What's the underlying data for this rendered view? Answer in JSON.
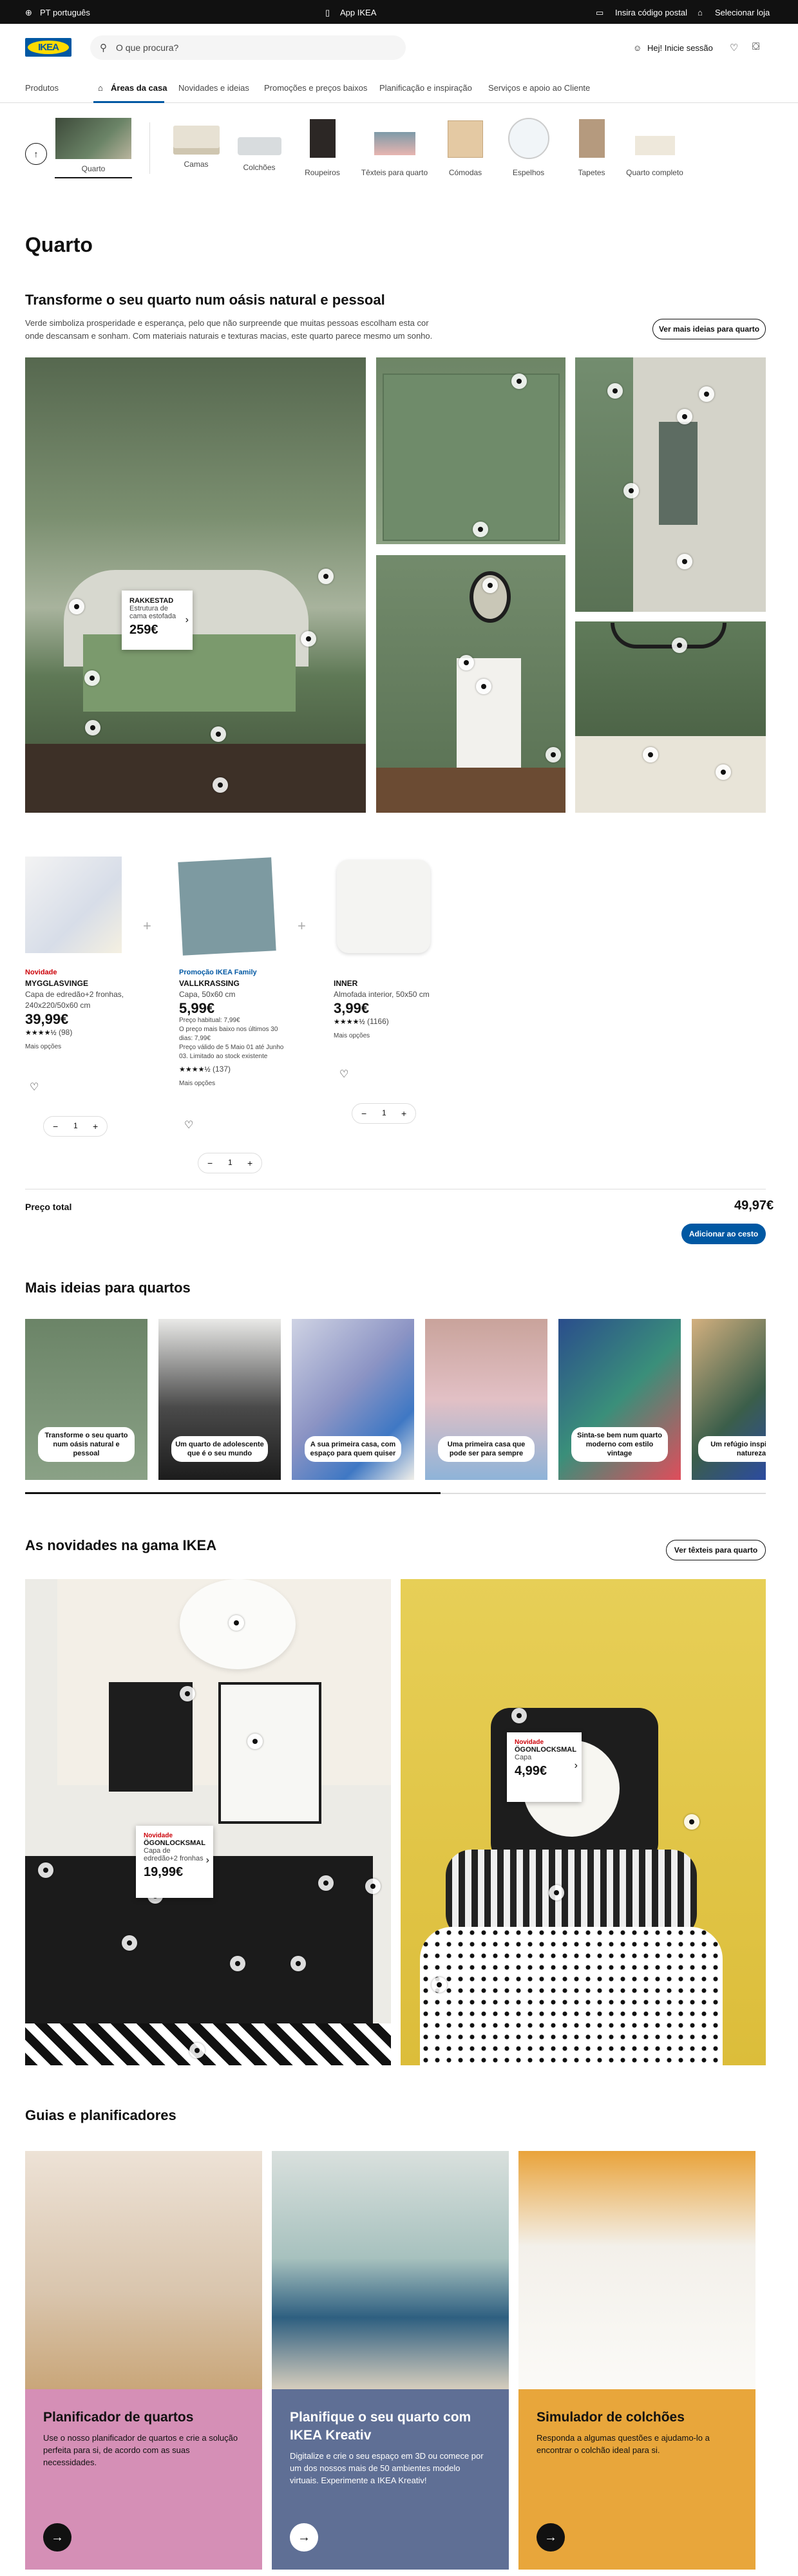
{
  "topbar": {
    "country": "PT",
    "language": "português",
    "app": "App IKEA",
    "postal": "Insira código postal",
    "store": "Selecionar loja"
  },
  "header": {
    "logo": "IKEA",
    "search_placeholder": "O que procura?",
    "login": "Hej! Inicie sessão"
  },
  "nav": {
    "tabs": [
      "Produtos",
      "Áreas da casa",
      "Novidades e ideias",
      "Promoções e preços baixos",
      "Planificação e inspiração",
      "Serviços e apoio ao Cliente"
    ],
    "active": "Áreas da casa"
  },
  "categories": [
    "Quarto",
    "Camas",
    "Colchões",
    "Roupeiros",
    "Têxteis para quarto",
    "Cómodas",
    "Espelhos",
    "Tapetes",
    "Quarto completo"
  ],
  "page_title": "Quarto",
  "hero": {
    "title": "Transforme o seu quarto num oásis natural e pessoal",
    "description": "Verde simboliza prosperidade e esperança, pelo que não surpreende que muitas pessoas escolham esta cor onde descansam e sonham. Com materiais naturais e texturas macias, este quarto parece mesmo um sonho.",
    "more_button": "Ver mais ideias para quarto",
    "tag": {
      "name": "RAKKESTAD",
      "desc": "Estrutura de cama estofada",
      "price": "259€"
    }
  },
  "products": [
    {
      "label": "Novidade",
      "name": "MYGGLASVINGE",
      "desc": "Capa de edredão+2 fronhas, 240x220/50x60 cm",
      "price": "39,99€",
      "rating": "(98)",
      "more": "Mais opções",
      "qty": "1"
    },
    {
      "label": "Promoção IKEA Family",
      "name": "VALLKRASSING",
      "desc": "Capa, 50x60 cm",
      "price": "5,99€",
      "old1": "Preço habitual: 7,99€",
      "old2": "O preço mais baixo nos últimos 30 dias: 7,99€",
      "old3": "Preço válido de 5 Maio 01 até Junho 03. Limitado ao stock existente",
      "rating": "(137)",
      "more": "Mais opções",
      "qty": "1"
    },
    {
      "label": "",
      "name": "INNER",
      "desc": "Almofada interior, 50x50 cm",
      "price": "3,99€",
      "rating": "(1166)",
      "more": "Mais opções",
      "qty": "1"
    }
  ],
  "set_qty": "1",
  "total": {
    "label": "Preço total",
    "price": "49,97€",
    "add_button": "Adicionar ao cesto"
  },
  "ideas": {
    "title": "Mais ideias para quartos",
    "items": [
      "Transforme o seu quarto num oásis natural e pessoal",
      "Um quarto de adolescente que é o seu mundo",
      "A sua primeira casa, com espaço para quem quiser",
      "Uma primeira casa que pode ser para sempre",
      "Sinta-se bem num quarto moderno com estilo vintage",
      "Um refúgio inspirado na natureza"
    ]
  },
  "news": {
    "title": "As novidades na gama IKEA",
    "button": "Ver têxteis para quarto",
    "tag1": {
      "label": "Novidade",
      "name": "ÖGONLOCKSMAL",
      "desc": "Capa de edredão+2 fronhas",
      "price": "19,99€"
    },
    "tag2": {
      "label": "Novidade",
      "name": "ÖGONLOCKSMAL",
      "desc": "Capa",
      "price": "4,99€"
    }
  },
  "guides": {
    "title": "Guias e planificadores",
    "items": [
      {
        "title": "Planificador de quartos",
        "text": "Use o nosso planificador de quartos e crie a solução perfeita para si, de acordo com as suas necessidades."
      },
      {
        "title": "Planifique o seu quarto com IKEA Kreativ",
        "text": "Digitalize e crie o seu espaço em 3D ou comece por um dos nossos mais de 50 ambientes modelo virtuais. Experimente a IKEA Kreativ!"
      },
      {
        "title": "Simulador de colchões",
        "text": "Responda a algumas questões e ajudamo-lo a encontrar o colchão ideal para si."
      }
    ]
  },
  "colors": {
    "brand_blue": "#0058a3",
    "brand_yellow": "#ffdb00",
    "green_room": "#6b8467",
    "guide_pink": "#d58fb6",
    "guide_blue": "#5f6f95",
    "guide_orange": "#e8a63b"
  }
}
